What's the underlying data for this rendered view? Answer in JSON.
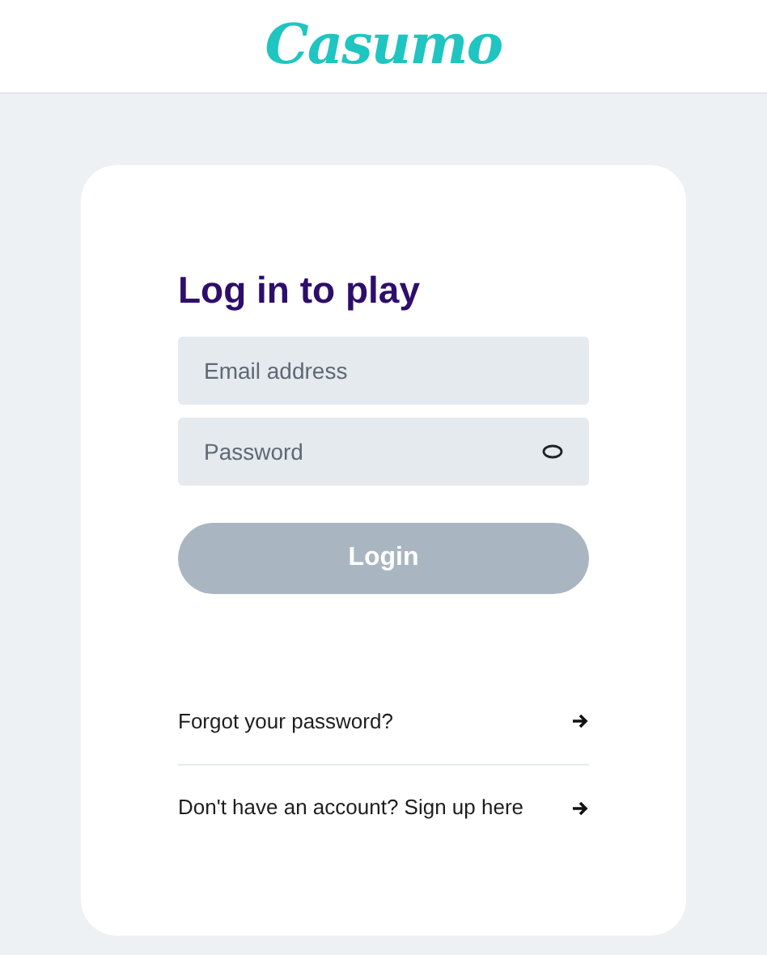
{
  "header": {
    "logo": "Casumo"
  },
  "form": {
    "title": "Log in to play",
    "fields": [
      {
        "kind": "email",
        "placeholder": "Email address"
      },
      {
        "kind": "password",
        "placeholder": "Password"
      }
    ],
    "submit": {
      "label": "Login",
      "disabled": true
    }
  },
  "links": [
    {
      "label": "Forgot your password?"
    },
    {
      "label": "Don't have an account? Sign up here"
    }
  ]
}
